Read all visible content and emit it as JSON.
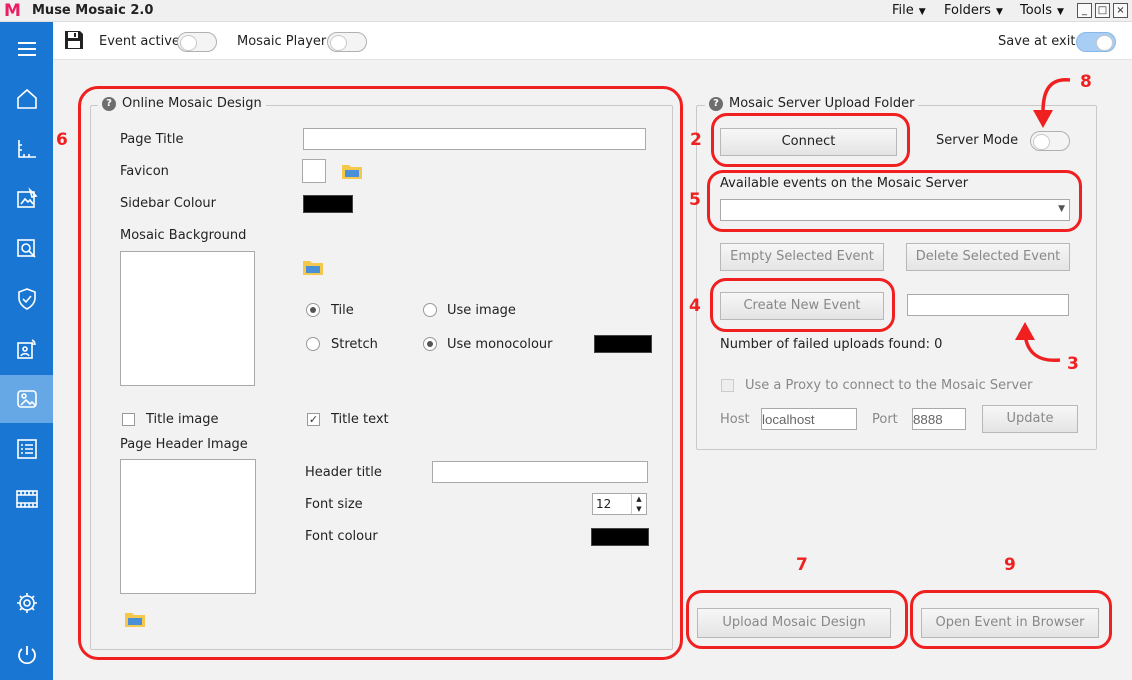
{
  "titlebar": {
    "app_title": "Muse Mosaic 2.0",
    "logo_letter": "M",
    "menus": [
      "File",
      "Folders",
      "Tools"
    ],
    "window_buttons": {
      "minimize": "_",
      "maximize": "□",
      "close": "×"
    }
  },
  "sidebar": {
    "items": [
      {
        "icon": "hamburger-icon"
      },
      {
        "icon": "home-icon"
      },
      {
        "icon": "ruler-icon"
      },
      {
        "icon": "image-edit-icon"
      },
      {
        "icon": "search-image-icon"
      },
      {
        "icon": "shield-icon"
      },
      {
        "icon": "presentation-icon"
      },
      {
        "icon": "mosaic-image-icon",
        "active": true
      },
      {
        "icon": "checklist-icon"
      },
      {
        "icon": "film-icon"
      },
      {
        "icon": "gear-icon"
      },
      {
        "icon": "power-icon"
      }
    ],
    "colors": {
      "background": "#1976d2",
      "active": "#66a8e6"
    }
  },
  "toolbar": {
    "event_active_label": "Event active",
    "event_active_on": false,
    "mosaic_player_label": "Mosaic Player",
    "mosaic_player_on": false,
    "save_at_exit_label": "Save at exit",
    "save_at_exit_on": true
  },
  "design": {
    "group_title": "Online Mosaic Design",
    "page_title_label": "Page Title",
    "page_title_value": "",
    "favicon_label": "Favicon",
    "sidebar_colour_label": "Sidebar Colour",
    "sidebar_colour": "#000000",
    "mosaic_background_label": "Mosaic Background",
    "tile_label": "Tile",
    "use_image_label": "Use image",
    "stretch_label": "Stretch",
    "use_monocolour_label": "Use monocolour",
    "mono_colour": "#000000",
    "title_image_label": "Title image",
    "title_text_label": "Title text",
    "title_image_checked": false,
    "title_text_checked": true,
    "page_header_image_label": "Page Header Image",
    "header_title_label": "Header title",
    "header_title_value": "",
    "font_size_label": "Font size",
    "font_size_value": "12",
    "font_colour_label": "Font colour",
    "font_colour": "#000000"
  },
  "server": {
    "group_title": "Mosaic Server Upload Folder",
    "connect_label": "Connect",
    "server_mode_label": "Server Mode",
    "server_mode_on": false,
    "available_events_label": "Available events on the Mosaic Server",
    "selected_event": "",
    "empty_selected_label": "Empty Selected Event",
    "delete_selected_label": "Delete Selected Event",
    "create_new_label": "Create New Event",
    "new_event_name": "",
    "failed_uploads_label": "Number of failed uploads found: 0",
    "proxy_label": "Use a Proxy to connect to the Mosaic Server",
    "host_label": "Host",
    "host_value": "localhost",
    "port_label": "Port",
    "port_value": "8888",
    "update_label": "Update"
  },
  "actions": {
    "upload_label": "Upload Mosaic Design",
    "open_browser_label": "Open Event in Browser"
  },
  "annotations": {
    "n2": "2",
    "n3": "3",
    "n4": "4",
    "n5": "5",
    "n6": "6",
    "n7": "7",
    "n8": "8",
    "n9": "9",
    "color": "#f02020"
  }
}
